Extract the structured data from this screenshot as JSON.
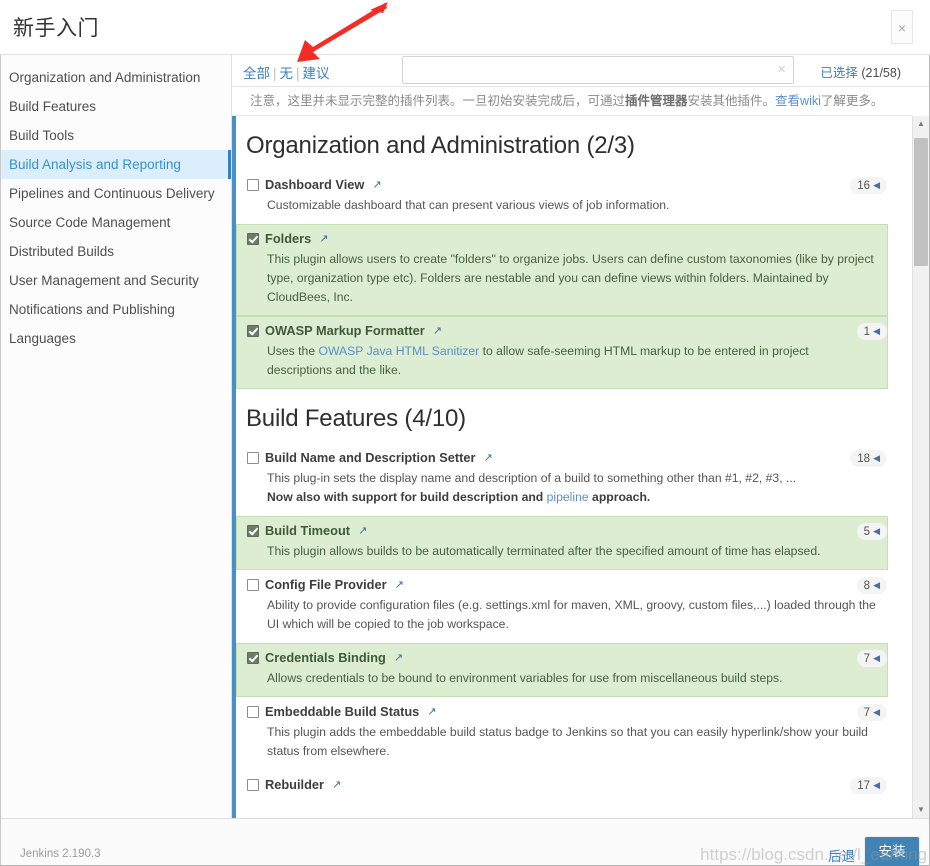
{
  "window": {
    "title": "新手入门",
    "close_label": "×"
  },
  "sidebar": {
    "items": [
      {
        "label": "Organization and Administration",
        "active": false
      },
      {
        "label": "Build Features",
        "active": false
      },
      {
        "label": "Build Tools",
        "active": false
      },
      {
        "label": "Build Analysis and Reporting",
        "active": true
      },
      {
        "label": "Pipelines and Continuous Delivery",
        "active": false
      },
      {
        "label": "Source Code Management",
        "active": false
      },
      {
        "label": "Distributed Builds",
        "active": false
      },
      {
        "label": "User Management and Security",
        "active": false
      },
      {
        "label": "Notifications and Publishing",
        "active": false
      },
      {
        "label": "Languages",
        "active": false
      }
    ]
  },
  "filterbar": {
    "all_label": "全部",
    "none_label": "无",
    "suggested_label": "建议",
    "separator": "|",
    "search_value": "",
    "search_placeholder": "",
    "clear_icon": "×",
    "selected_label": "已选择",
    "selected_count": "(21/58)"
  },
  "notice": {
    "text_1": "注意，这里并未显示完整的插件列表。一旦初始安装完成后，可通过",
    "bold_1": "插件管理器",
    "text_2": "安装其他插件。",
    "link_label": "查看wiki",
    "text_3": "了解更多。"
  },
  "sections": [
    {
      "title": "Organization and Administration (2/3)",
      "plugins": [
        {
          "name": "Dashboard View",
          "checked": false,
          "version": "16",
          "desc_parts": [
            {
              "type": "text",
              "value": "Customizable dashboard that can present various views of job information."
            }
          ]
        },
        {
          "name": "Folders",
          "checked": true,
          "version": "",
          "desc_parts": [
            {
              "type": "text",
              "value": "This plugin allows users to create \"folders\" to organize jobs. Users can define custom taxonomies (like by project type, organization type etc). Folders are nestable and you can define views within folders. Maintained by CloudBees, Inc."
            }
          ]
        },
        {
          "name": "OWASP Markup Formatter",
          "checked": true,
          "version": "1",
          "desc_parts": [
            {
              "type": "text",
              "value": "Uses the "
            },
            {
              "type": "link",
              "value": "OWASP Java HTML Sanitizer"
            },
            {
              "type": "text",
              "value": " to allow safe-seeming HTML markup to be entered in project descriptions and the like."
            }
          ]
        }
      ]
    },
    {
      "title": "Build Features (4/10)",
      "plugins": [
        {
          "name": "Build Name and Description Setter",
          "checked": false,
          "version": "18",
          "desc_parts": [
            {
              "type": "text",
              "value": "This plug-in sets the display name and description of a build to something other than #1, #2, #3, ..."
            },
            {
              "type": "break",
              "value": ""
            },
            {
              "type": "bold",
              "value": "Now also with support for build description and "
            },
            {
              "type": "link",
              "value": "pipeline"
            },
            {
              "type": "bold",
              "value": " approach."
            }
          ]
        },
        {
          "name": "Build Timeout",
          "checked": true,
          "version": "5",
          "desc_parts": [
            {
              "type": "text",
              "value": "This plugin allows builds to be automatically terminated after the specified amount of time has elapsed."
            }
          ]
        },
        {
          "name": "Config File Provider",
          "checked": false,
          "version": "8",
          "desc_parts": [
            {
              "type": "text",
              "value": "Ability to provide configuration files (e.g. settings.xml for maven, XML, groovy, custom files,...) loaded through the UI which will be copied to the job workspace."
            }
          ]
        },
        {
          "name": "Credentials Binding",
          "checked": true,
          "version": "7",
          "desc_parts": [
            {
              "type": "text",
              "value": "Allows credentials to be bound to environment variables for use from miscellaneous build steps."
            }
          ]
        },
        {
          "name": "Embeddable Build Status",
          "checked": false,
          "version": "7",
          "desc_parts": [
            {
              "type": "text",
              "value": "This plugin adds the embeddable build status badge to Jenkins so that you can easily hyperlink/show your build status from elsewhere."
            }
          ]
        },
        {
          "name": "Rebuilder",
          "checked": false,
          "version": "17",
          "desc_parts": []
        }
      ]
    }
  ],
  "icons": {
    "external_link": "↗",
    "badge_triangle": "◀",
    "scroll_up": "▲",
    "scroll_down": "▼"
  },
  "footer": {
    "version": "Jenkins 2.190.3",
    "back_label": "后退",
    "install_label": "安装",
    "watermark": "https://blog.csdn.net/l_earning"
  },
  "annotation": {
    "arrow_color": "#f42c23"
  }
}
